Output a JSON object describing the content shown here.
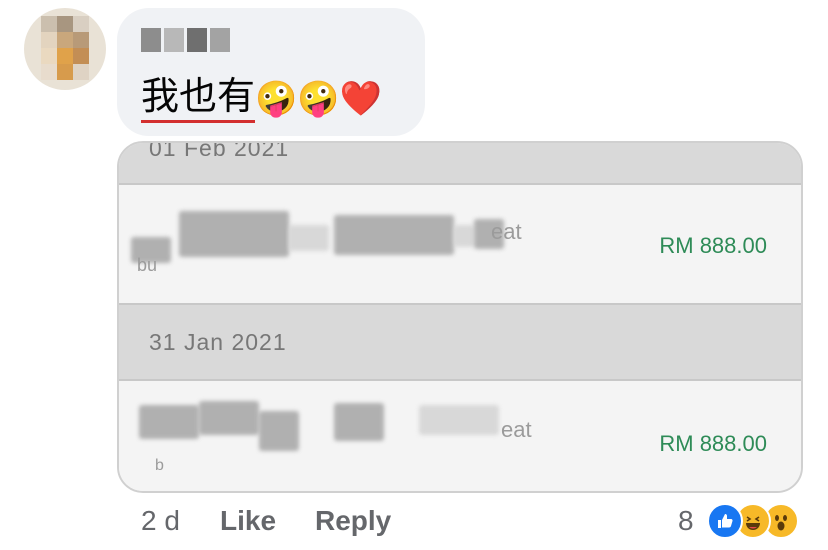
{
  "comment": {
    "text_cjk": "我也有",
    "emojis": [
      "🤪",
      "🤪",
      "❤️"
    ]
  },
  "transactions": [
    {
      "date": "01 Feb 2021",
      "faint_text": "eat",
      "faint_text_2": "bu",
      "amount": "RM 888.00"
    },
    {
      "date": "31 Jan 2021",
      "faint_text": "eat",
      "faint_text_2": "b",
      "amount": "RM 888.00"
    }
  ],
  "footer": {
    "age": "2 d",
    "like_label": "Like",
    "reply_label": "Reply",
    "reaction_count": "8"
  },
  "reactions": [
    "like-icon",
    "haha-icon",
    "wow-icon"
  ],
  "colors": {
    "amount_green": "#2e8b57",
    "like_blue": "#1877f2",
    "reaction_yellow": "#f7b928",
    "underline_red": "#d32f2f"
  }
}
